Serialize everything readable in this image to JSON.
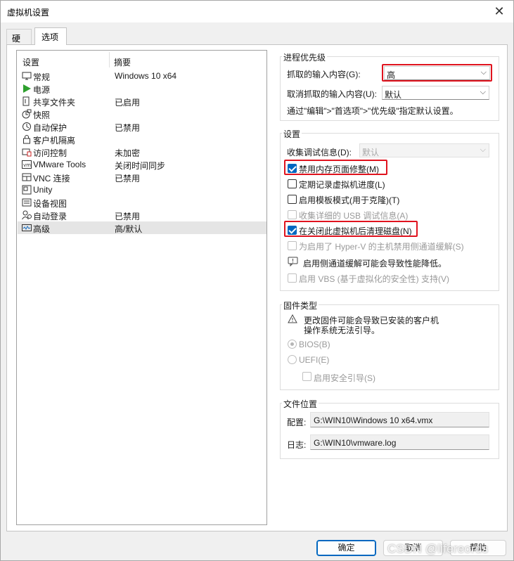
{
  "window": {
    "title": "虚拟机设置",
    "close_glyph": "✕"
  },
  "tabs": [
    {
      "label": "硬件",
      "active": false
    },
    {
      "label": "选项",
      "active": true
    }
  ],
  "list": {
    "headers": {
      "setting": "设置",
      "summary": "摘要"
    },
    "items": [
      {
        "icon": "monitor-icon",
        "name": "常规",
        "summary": "Windows 10 x64"
      },
      {
        "icon": "play-icon",
        "name": "电源",
        "summary": ""
      },
      {
        "icon": "shared-folder-icon",
        "name": "共享文件夹",
        "summary": "已启用"
      },
      {
        "icon": "snapshot-icon",
        "name": "快照",
        "summary": ""
      },
      {
        "icon": "autoprotect-icon",
        "name": "自动保护",
        "summary": "已禁用"
      },
      {
        "icon": "lock-icon",
        "name": "客户机隔离",
        "summary": ""
      },
      {
        "icon": "access-control-icon",
        "name": "访问控制",
        "summary": "未加密"
      },
      {
        "icon": "vmware-tools-icon",
        "name": "VMware Tools",
        "summary": "关闭时间同步"
      },
      {
        "icon": "vnc-icon",
        "name": "VNC 连接",
        "summary": "已禁用"
      },
      {
        "icon": "unity-icon",
        "name": "Unity",
        "summary": ""
      },
      {
        "icon": "appliance-view-icon",
        "name": "设备视图",
        "summary": ""
      },
      {
        "icon": "autologin-icon",
        "name": "自动登录",
        "summary": "已禁用"
      },
      {
        "icon": "advanced-icon",
        "name": "高级",
        "summary": "高/默认"
      }
    ],
    "selected_index": 12
  },
  "process_priority": {
    "title": "进程优先级",
    "grabbed_label": "抓取的输入内容(G):",
    "grabbed_value": "高",
    "ungrabbed_label": "取消抓取的输入内容(U):",
    "ungrabbed_value": "默认",
    "hint": "通过\"编辑\">\"首选项\">\"优先级\"指定默认设置。"
  },
  "settings": {
    "title": "设置",
    "debug_label": "收集调试信息(D):",
    "debug_value": "默认",
    "options": [
      {
        "label": "禁用内存页面修整(M)",
        "checked": true,
        "disabled": false
      },
      {
        "label": "定期记录虚拟机进度(L)",
        "checked": false,
        "disabled": false
      },
      {
        "label": "启用模板模式(用于克隆)(T)",
        "checked": false,
        "disabled": false
      },
      {
        "label": "收集详细的 USB 调试信息(A)",
        "checked": false,
        "disabled": true
      },
      {
        "label": "在关闭此虚拟机后清理磁盘(N)",
        "checked": true,
        "disabled": false
      },
      {
        "label": "为启用了 Hyper-V 的主机禁用侧通道缓解(S)",
        "checked": false,
        "disabled": true
      }
    ],
    "info_text": "启用侧通道缓解可能会导致性能降低。",
    "vbs_label": "启用 VBS (基于虚拟化的安全性) 支持(V)"
  },
  "firmware": {
    "title": "固件类型",
    "warning_line1": "更改固件可能会导致已安装的客户机",
    "warning_line2": "操作系统无法引导。",
    "bios_label": "BIOS(B)",
    "uefi_label": "UEFI(E)",
    "secure_boot_label": "启用安全引导(S)"
  },
  "file_location": {
    "title": "文件位置",
    "config_label": "配置:",
    "config_value": "G:\\WIN10\\Windows 10 x64.vmx",
    "log_label": "日志:",
    "log_value": "G:\\WIN10\\vmware.log"
  },
  "buttons": {
    "ok": "确定",
    "cancel": "取消",
    "help": "帮助"
  },
  "watermark": "CSDN @lifereords"
}
